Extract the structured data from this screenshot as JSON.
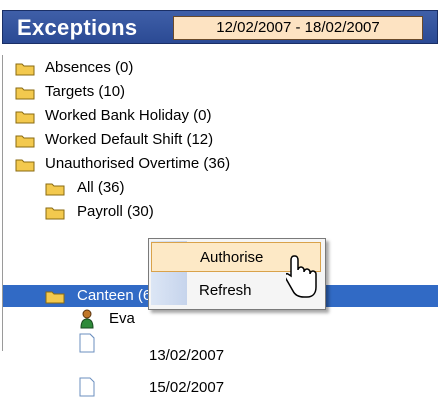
{
  "header": {
    "title": "Exceptions",
    "date_range": "12/02/2007 - 18/02/2007"
  },
  "tree": {
    "items": [
      {
        "label": "Absences (0)"
      },
      {
        "label": "Targets (10)"
      },
      {
        "label": "Worked Bank Holiday (0)"
      },
      {
        "label": "Worked Default Shift (12)"
      },
      {
        "label": "Unauthorised Overtime (36)"
      },
      {
        "label": "All (36)"
      },
      {
        "label": "Payroll (30)"
      },
      {
        "label": "Canteen (6)"
      }
    ],
    "person_label": "Eva",
    "dates": [
      "13/02/2007",
      "15/02/2007"
    ]
  },
  "context_menu": {
    "items": [
      {
        "label": "Authorise"
      },
      {
        "label": "Refresh"
      }
    ]
  },
  "colors": {
    "header_bg": "#2b4a94",
    "date_bg": "#fde3c2",
    "selection": "#316ac5",
    "menu_highlight": "#fde9c6"
  }
}
